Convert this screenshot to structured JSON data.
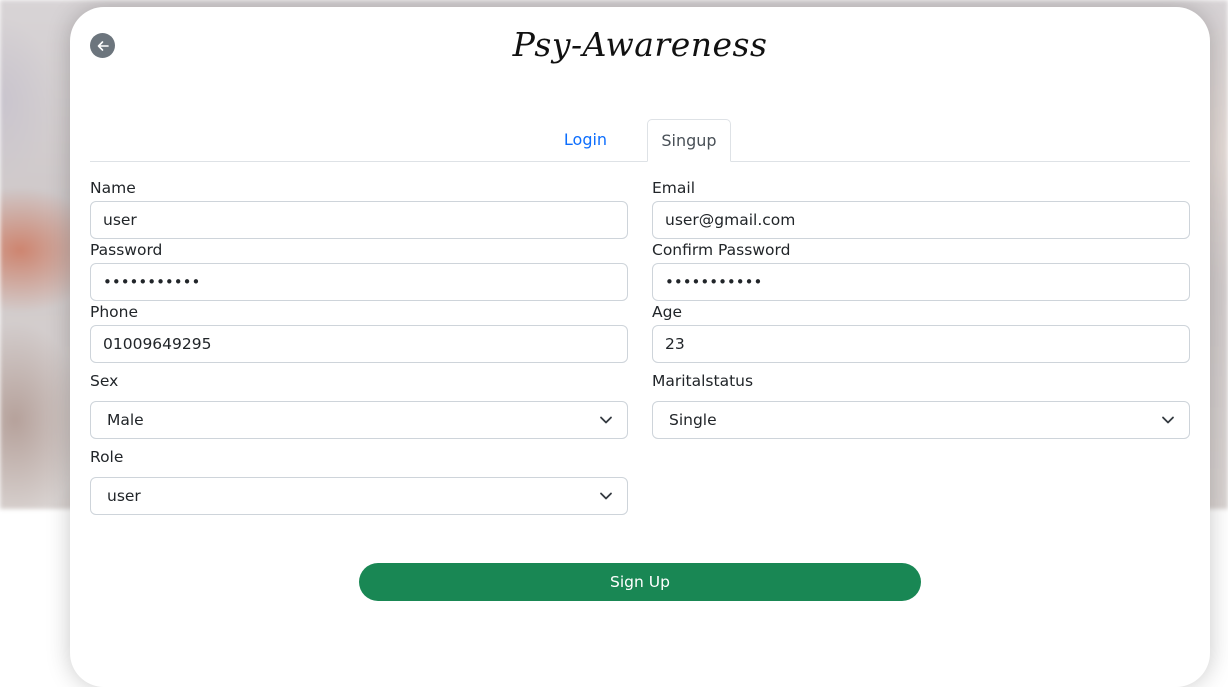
{
  "app": {
    "title": "Psy-Awareness"
  },
  "tabs": [
    {
      "label": "Login",
      "active": false
    },
    {
      "label": "Singup",
      "active": true
    }
  ],
  "form": {
    "name": {
      "label": "Name",
      "value": "user"
    },
    "email": {
      "label": "Email",
      "value": "user@gmail.com"
    },
    "password": {
      "label": "Password",
      "value": "•••••••••••"
    },
    "confirm_password": {
      "label": "Confirm Password",
      "value": "•••••••••••"
    },
    "phone": {
      "label": "Phone",
      "value": "01009649295"
    },
    "age": {
      "label": "Age",
      "value": "23"
    },
    "sex": {
      "label": "Sex",
      "selected": "Male"
    },
    "marital_status": {
      "label": "Maritalstatus",
      "selected": "Single"
    },
    "role": {
      "label": "Role",
      "selected": "user"
    },
    "submit_label": "Sign Up"
  },
  "icons": {
    "back": "arrow-left-icon",
    "dropdown": "chevron-down-icon"
  },
  "colors": {
    "accent_link": "#0d6efd",
    "submit_button": "#198754",
    "back_button": "#6c757d"
  }
}
